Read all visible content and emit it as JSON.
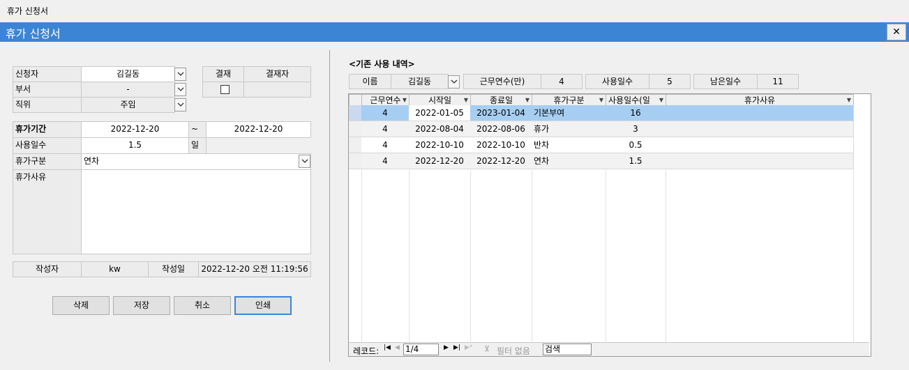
{
  "window": {
    "caption": "휴가 신청서",
    "title": "휴가 신청서",
    "close": "✕"
  },
  "form": {
    "applicant": {
      "label": "신청자",
      "value": "김길동"
    },
    "dept": {
      "label": "부서",
      "value": "-"
    },
    "position": {
      "label": "직위",
      "value": "주임"
    },
    "approval": {
      "label": "결재",
      "approver_label": "결재자",
      "approver_value": ""
    },
    "period": {
      "label": "휴가기간",
      "start": "2022-12-20",
      "sep": "~",
      "end": "2022-12-20"
    },
    "days": {
      "label": "사용일수",
      "value": "1.5",
      "unit": "일"
    },
    "type": {
      "label": "휴가구분",
      "value": "연차"
    },
    "reason": {
      "label": "휴가사유",
      "value": ""
    },
    "writer": {
      "label": "작성자",
      "value": "kw",
      "date_label": "작성일",
      "date_value": "2022-12-20 오전 11:19:56"
    }
  },
  "buttons": {
    "delete": "삭제",
    "save": "저장",
    "cancel": "취소",
    "print": "인쇄"
  },
  "history": {
    "title": "<기존 사용 내역>",
    "name_label": "이름",
    "name_value": "김길동",
    "years_label": "근무연수(만)",
    "years_value": "4",
    "used_label": "사용일수",
    "used_value": "5",
    "remain_label": "남은일수",
    "remain_value": "11",
    "columns": [
      "근무연수",
      "시작일",
      "종료일",
      "휴가구분",
      "사용일수(일",
      "휴가사유"
    ],
    "rows": [
      {
        "years": "4",
        "start": "2022-01-05",
        "end": "2023-01-04",
        "type": "기본부여",
        "days": "16",
        "reason": ""
      },
      {
        "years": "4",
        "start": "2022-08-04",
        "end": "2022-08-06",
        "type": "휴가",
        "days": "3",
        "reason": ""
      },
      {
        "years": "4",
        "start": "2022-10-10",
        "end": "2022-10-10",
        "type": "반차",
        "days": "0.5",
        "reason": ""
      },
      {
        "years": "4",
        "start": "2022-12-20",
        "end": "2022-12-20",
        "type": "연차",
        "days": "1.5",
        "reason": ""
      }
    ],
    "nav": {
      "record_label": "레코드:",
      "position": "1/4",
      "filter": "필터 없음",
      "search": "검색"
    }
  }
}
